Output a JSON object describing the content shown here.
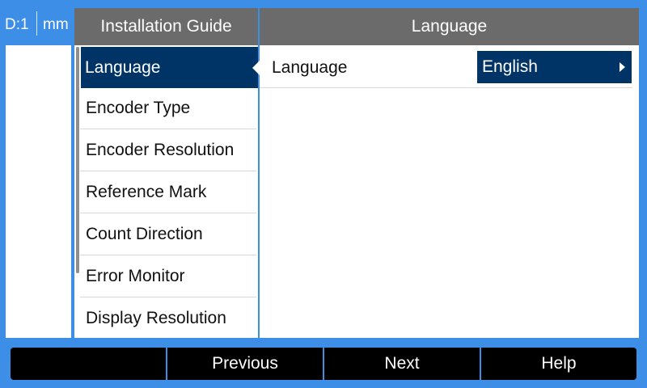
{
  "status": {
    "axis": "D:1",
    "unit": "mm"
  },
  "menu": {
    "title": "Installation Guide",
    "items": [
      {
        "label": "Language"
      },
      {
        "label": "Encoder Type"
      },
      {
        "label": "Encoder Resolution"
      },
      {
        "label": "Reference Mark"
      },
      {
        "label": "Count Direction"
      },
      {
        "label": "Error Monitor"
      },
      {
        "label": "Display Resolution"
      }
    ],
    "selected_index": 0
  },
  "detail": {
    "title": "Language",
    "setting_label": "Language",
    "setting_value": "English"
  },
  "softkeys": [
    "",
    "Previous",
    "Next",
    "Help"
  ],
  "colors": {
    "background": "#3d8ee6",
    "header": "#6b6b6b",
    "selection": "#003467",
    "softkey_bar": "#000000"
  }
}
